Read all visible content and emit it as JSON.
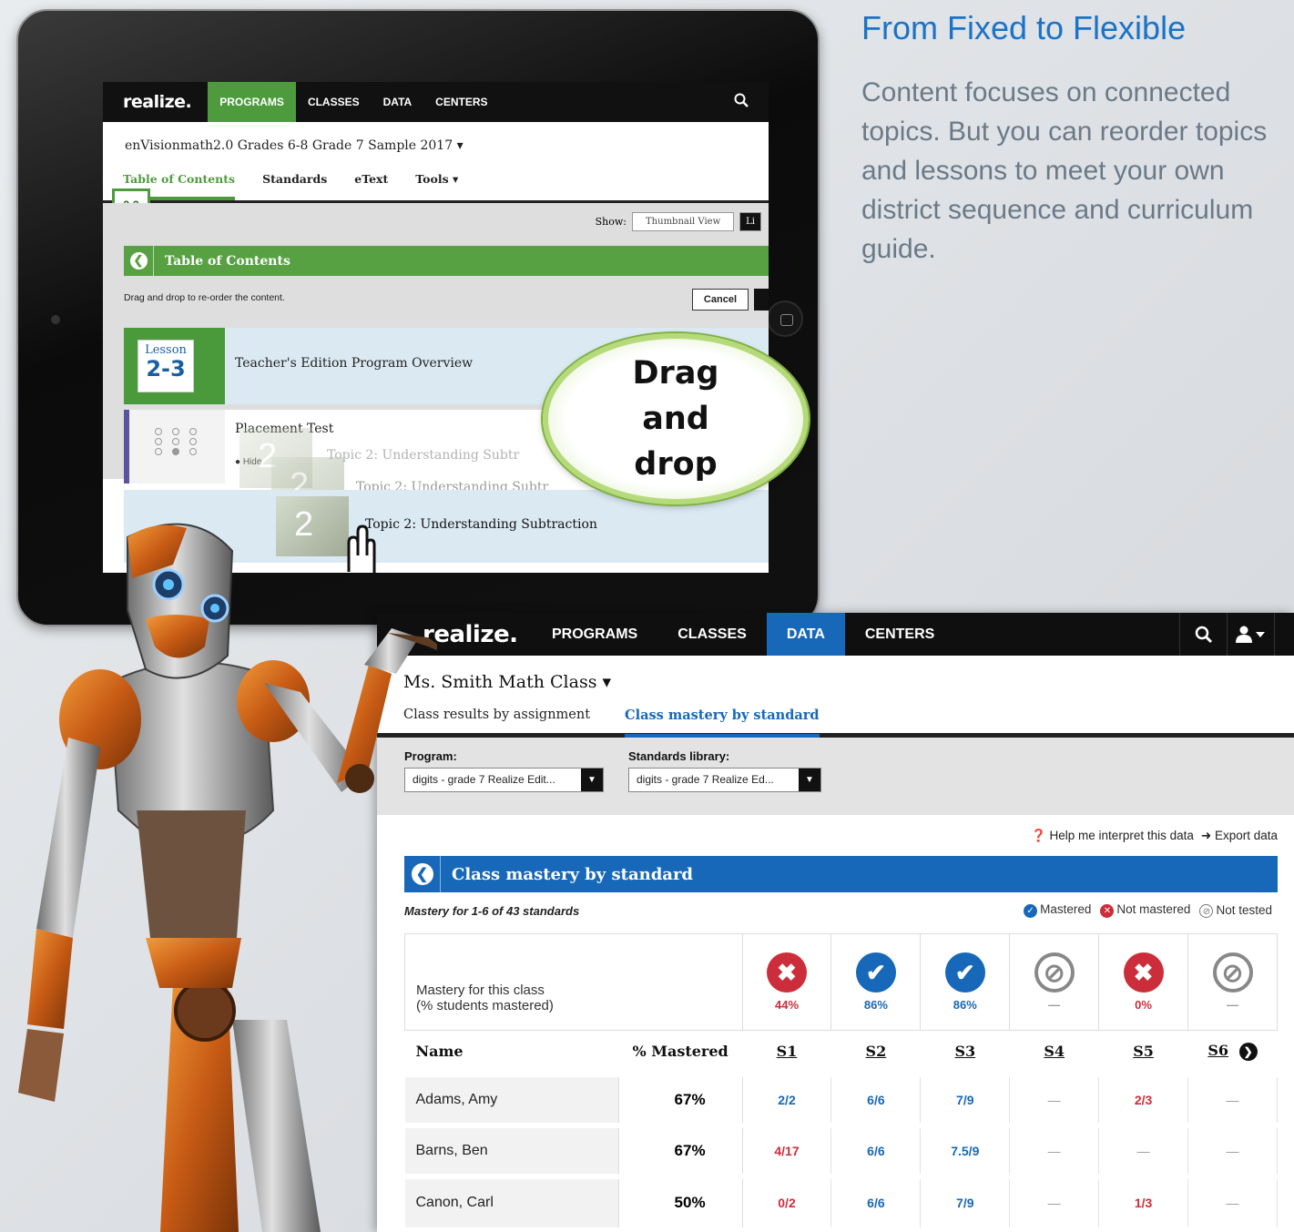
{
  "promo": {
    "title": "From Fixed to Flexible",
    "body": "Content focuses on connected topics. But you can reorder topics and lessons to meet your own district sequence and curriculum guide."
  },
  "tablet": {
    "logo": "realize.",
    "nav": [
      "PROGRAMS",
      "CLASSES",
      "DATA",
      "CENTERS"
    ],
    "course_title": "enVisionmath2.0 Grades 6-8 Grade 7 Sample 2017 ▾",
    "tabs": [
      "Table of Contents",
      "Standards",
      "eText",
      "Tools ▾"
    ],
    "lesson_chip": "2-3",
    "show_label": "Show:",
    "thumbnail_view": "Thumbnail View",
    "list_view": "Li",
    "toc_title": "Table of Contents",
    "drag_instruction": "Drag and drop to re-order the content.",
    "cancel": "Cancel",
    "lesson_card_top": "Lesson",
    "lesson_card_num": "2-3",
    "row1_title": "Teacher's Edition Program Overview",
    "row2_title": "Placement Test",
    "hide": "Hide",
    "ghost_1": "Topic 2: Understanding Subtr",
    "ghost_2": "Topic 2: Understanding Subtr",
    "row3_title": "Topic 2: Understanding Subtraction",
    "topic_badge": "2",
    "callout": "Drag and drop"
  },
  "dashboard": {
    "logo": "realize.",
    "nav": [
      "PROGRAMS",
      "CLASSES",
      "DATA",
      "CENTERS"
    ],
    "class_name": "Ms. Smith Math Class ▾",
    "tabs": [
      "Class results by assignment",
      "Class mastery by standard"
    ],
    "program_label": "Program:",
    "program_value": "digits - grade 7 Realize Edit...",
    "library_label": "Standards library:",
    "library_value": "digits - grade 7 Realize Ed...",
    "help": "Help me interpret this data",
    "export": "Export data",
    "bar_title": "Class mastery by standard",
    "subhead": "Mastery for 1-6 of 43 standards",
    "legend": {
      "mastered": "Mastered",
      "not_mastered": "Not mastered",
      "not_tested": "Not tested"
    },
    "mastery_label_1": "Mastery for this class",
    "mastery_label_2": "(% students mastered)",
    "mastery": [
      {
        "status": "not_mastered",
        "pct": "44%"
      },
      {
        "status": "mastered",
        "pct": "86%"
      },
      {
        "status": "mastered",
        "pct": "86%"
      },
      {
        "status": "not_tested",
        "pct": "—"
      },
      {
        "status": "not_mastered",
        "pct": "0%"
      },
      {
        "status": "not_tested",
        "pct": "—"
      }
    ],
    "headers": {
      "name": "Name",
      "pct": "% Mastered",
      "standards": [
        "S1",
        "S2",
        "S3",
        "S4",
        "S5",
        "S6"
      ]
    },
    "students": [
      {
        "name": "Adams, Amy",
        "pct": "67%",
        "scores": [
          "2/2",
          "6/6",
          "7/9",
          "—",
          "2/3",
          "—"
        ],
        "colors": [
          "blue",
          "blue",
          "blue",
          "gray",
          "red",
          "gray"
        ]
      },
      {
        "name": "Barns, Ben",
        "pct": "67%",
        "scores": [
          "4/17",
          "6/6",
          "7.5/9",
          "—",
          "—",
          "—"
        ],
        "colors": [
          "red",
          "blue",
          "blue",
          "gray",
          "gray",
          "gray"
        ]
      },
      {
        "name": "Canon, Carl",
        "pct": "50%",
        "scores": [
          "0/2",
          "6/6",
          "7/9",
          "—",
          "1/3",
          "—"
        ],
        "colors": [
          "red",
          "blue",
          "blue",
          "gray",
          "red",
          "gray"
        ]
      }
    ]
  },
  "colors": {
    "green": "#4d9b3d",
    "blue": "#1768b8",
    "red": "#cc2d3a",
    "promo_blue": "#1a73c6"
  }
}
